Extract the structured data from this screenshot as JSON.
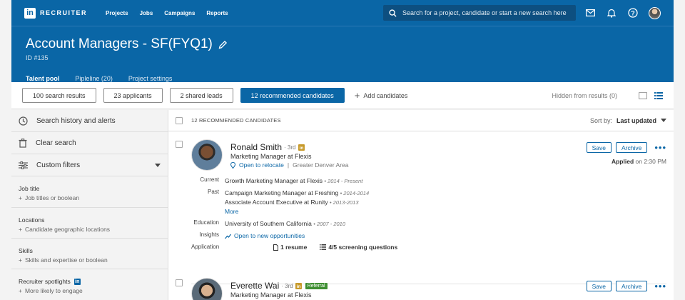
{
  "nav": {
    "logo_letters": "in",
    "logo_text": "RECRUITER",
    "links": [
      "Projects",
      "Jobs",
      "Campaigns",
      "Reports"
    ],
    "search_placeholder": "Search for a project, candidate or start a new search here"
  },
  "project": {
    "title": "Account Managers - SF(FYQ1)",
    "id": "ID #135",
    "tabs": [
      "Talent pool",
      "Pipleline (20)",
      "Project settings"
    ]
  },
  "filters": {
    "buttons": [
      "100 search results",
      "23 applicants",
      "2 shared leads",
      "12 recommended candidates"
    ],
    "add_candidates": "Add candidates",
    "hidden": "Hidden from results (0)"
  },
  "sidebar": {
    "rows": [
      "Search history and alerts",
      "Clear search",
      "Custom filters"
    ],
    "groups": [
      {
        "label": "Job title",
        "add": "Job titles or boolean"
      },
      {
        "label": "Locations",
        "add": "Candidate geographic locations"
      },
      {
        "label": "Skills",
        "add": "Skills and expertise or boolean"
      },
      {
        "label": "Recruiter spotlights",
        "add": "More likely to engage"
      }
    ]
  },
  "main": {
    "count": "12 RECOMMENDED CANDIDATES",
    "sort_label": "Sort by:",
    "sort_value": "Last updated"
  },
  "candidates": [
    {
      "name": "Ronald Smith",
      "degree": "· 3rd",
      "headline": "Marketing Manager at Flexis",
      "relocate": "Open to relocate",
      "area": "Greater Denver Area",
      "save": "Save",
      "archive": "Archive",
      "applied": "Applied",
      "applied_time": "on 2:30 PM",
      "labels": {
        "current": "Current",
        "past": "Past",
        "education": "Education",
        "insights": "Insights",
        "application": "Application"
      },
      "current": "Growth Marketing Manager at Flexis",
      "current_dates": "• 2014 - Present",
      "past": [
        {
          "title": "Campaign Marketing Manager at Freshing",
          "dates": "• 2014-2014"
        },
        {
          "title": "Associate Account Executive at Runity",
          "dates": "• 2013-2013"
        }
      ],
      "more": "More",
      "education": "University of Southern California",
      "education_dates": "• 2007 - 2010",
      "insight": "Open to new opportunities",
      "resume": "1 resume",
      "screening": "4/5 screening questions"
    },
    {
      "name": "Everette Wai",
      "degree": "· 3rd",
      "referral": "Referral",
      "headline": "Marketing Manager at Flexis",
      "save": "Save",
      "archive": "Archive"
    }
  ],
  "colors": {
    "brand": "#0a66a6",
    "referral": "#3f8f32"
  }
}
